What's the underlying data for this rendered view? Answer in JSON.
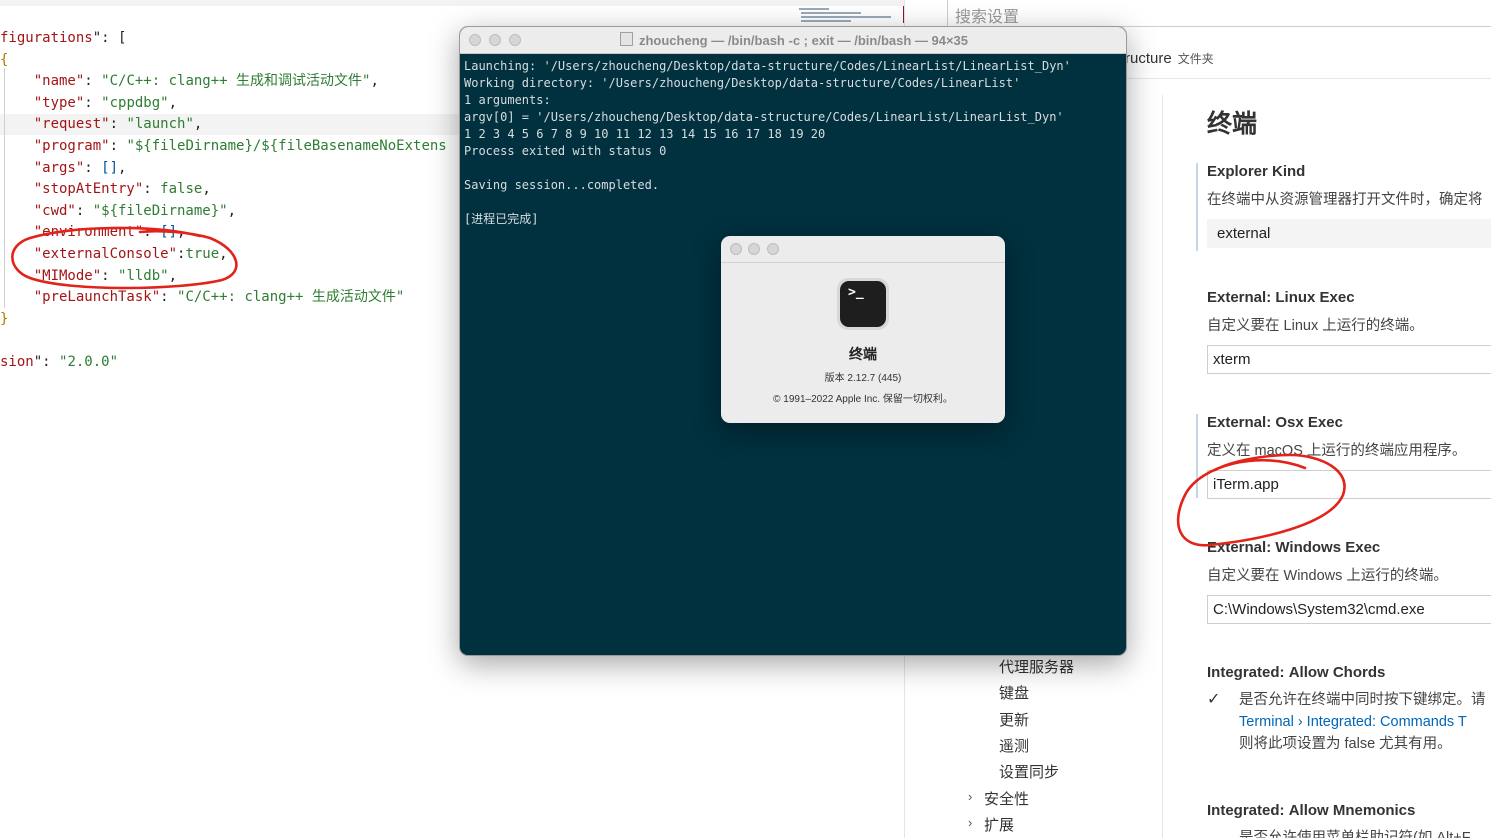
{
  "editor": {
    "lines": [
      [
        {
          "t": "figurations",
          "c": "k"
        },
        {
          "t": "\": [",
          "c": "p"
        }
      ],
      [
        {
          "t": "{",
          "c": "br"
        }
      ],
      [
        {
          "t": "    \"name\"",
          "c": "k"
        },
        {
          "t": ": ",
          "c": "p"
        },
        {
          "t": "\"C/C++: clang++ 生成和调试活动文件\"",
          "c": "s"
        },
        {
          "t": ",",
          "c": "p"
        }
      ],
      [
        {
          "t": "    \"type\"",
          "c": "k"
        },
        {
          "t": ": ",
          "c": "p"
        },
        {
          "t": "\"cppdbg\"",
          "c": "s"
        },
        {
          "t": ",",
          "c": "p"
        }
      ],
      [
        {
          "t": "    \"request\"",
          "c": "k"
        },
        {
          "t": ": ",
          "c": "p"
        },
        {
          "t": "\"launch\"",
          "c": "s"
        },
        {
          "t": ",",
          "c": "p"
        }
      ],
      [
        {
          "t": "    \"program\"",
          "c": "k"
        },
        {
          "t": ": ",
          "c": "p"
        },
        {
          "t": "\"${fileDirname}/${fileBasenameNoExtens",
          "c": "s"
        }
      ],
      [
        {
          "t": "    \"args\"",
          "c": "k"
        },
        {
          "t": ": ",
          "c": "p"
        },
        {
          "t": "[]",
          "c": "b"
        },
        {
          "t": ",",
          "c": "p"
        }
      ],
      [
        {
          "t": "    \"stopAtEntry\"",
          "c": "k"
        },
        {
          "t": ": ",
          "c": "p"
        },
        {
          "t": "false",
          "c": "s"
        },
        {
          "t": ",",
          "c": "p"
        }
      ],
      [
        {
          "t": "    \"cwd\"",
          "c": "k"
        },
        {
          "t": ": ",
          "c": "p"
        },
        {
          "t": "\"${fileDirname}\"",
          "c": "s"
        },
        {
          "t": ",",
          "c": "p"
        }
      ],
      [
        {
          "t": "    \"environment\"",
          "c": "k"
        },
        {
          "t": ": ",
          "c": "p"
        },
        {
          "t": "[]",
          "c": "b"
        },
        {
          "t": ",",
          "c": "p"
        }
      ],
      [
        {
          "t": "    \"externalConsole\"",
          "c": "k"
        },
        {
          "t": ":",
          "c": "p"
        },
        {
          "t": "true",
          "c": "s"
        },
        {
          "t": ",",
          "c": "p"
        }
      ],
      [
        {
          "t": "    \"MIMode\"",
          "c": "k"
        },
        {
          "t": ": ",
          "c": "p"
        },
        {
          "t": "\"lldb\"",
          "c": "s"
        },
        {
          "t": ",",
          "c": "p"
        }
      ],
      [
        {
          "t": "    \"preLaunchTask\"",
          "c": "k"
        },
        {
          "t": ": ",
          "c": "p"
        },
        {
          "t": "\"C/C++: clang++ 生成活动文件\"",
          "c": "s"
        }
      ],
      [
        {
          "t": "}",
          "c": "br"
        }
      ],
      [
        {
          "t": "",
          "c": "p"
        }
      ],
      [
        {
          "t": "sion",
          "c": "k"
        },
        {
          "t": "\": ",
          "c": "p"
        },
        {
          "t": "\"2.0.0\"",
          "c": "s"
        }
      ]
    ]
  },
  "settings": {
    "search_placeholder": "搜索设置",
    "breadcrumb": "ructure",
    "breadcrumb_scope": "文件夹",
    "tree_items": [
      "代理服务器",
      "键盘",
      "更新",
      "遥测",
      "设置同步"
    ],
    "tree_groups": [
      "安全性",
      "扩展"
    ],
    "section_title": "终端",
    "explorer_kind": {
      "name": "Explorer Kind",
      "desc": "在终端中从资源管理器打开文件时，确定将",
      "value": "external"
    },
    "linux_exec": {
      "category": "External:",
      "name": "Linux Exec",
      "desc": "自定义要在 Linux 上运行的终端。",
      "value": "xterm"
    },
    "osx_exec": {
      "category": "External:",
      "name": "Osx Exec",
      "desc": "定义在 macOS 上运行的终端应用程序。",
      "value": "iTerm.app"
    },
    "windows_exec": {
      "category": "External:",
      "name": "Windows Exec",
      "desc": "自定义要在 Windows 上运行的终端。",
      "value": "C:\\Windows\\System32\\cmd.exe"
    },
    "allow_chords": {
      "category": "Integrated:",
      "name": "Allow Chords",
      "desc": "是否允许在终端中同时按下键绑定。请",
      "link": "Terminal › Integrated: Commands T",
      "desc2": "则将此项设置为 false 尤其有用。"
    },
    "allow_mnemonics": {
      "category": "Integrated:",
      "name": "Allow Mnemonics",
      "desc": "是否允许使用菜单栏助记符(如 Alt+F"
    }
  },
  "terminal": {
    "title": "zhoucheng — /bin/bash -c ; exit — /bin/bash — 94×35",
    "lines": [
      "Launching: '/Users/zhoucheng/Desktop/data-structure/Codes/LinearList/LinearList_Dyn'",
      "Working directory: '/Users/zhoucheng/Desktop/data-structure/Codes/LinearList'",
      "1 arguments:",
      "argv[0] = '/Users/zhoucheng/Desktop/data-structure/Codes/LinearList/LinearList_Dyn'",
      "1 2 3 4 5 6 7 8 9 10 11 12 13 14 15 16 17 18 19 20",
      "Process exited with status 0",
      "",
      "Saving session...completed.",
      "",
      "[进程已完成]"
    ]
  },
  "about": {
    "app_name": "终端",
    "version": "版本 2.12.7 (445)",
    "copyright": "© 1991–2022 Apple Inc. 保留一切权利。",
    "icon": "terminal-app-icon"
  },
  "colors": {
    "terminal_bg": "#01303e",
    "annotation": "#e2231a",
    "json_key": "#a31515",
    "json_string": "#2e7d32"
  }
}
